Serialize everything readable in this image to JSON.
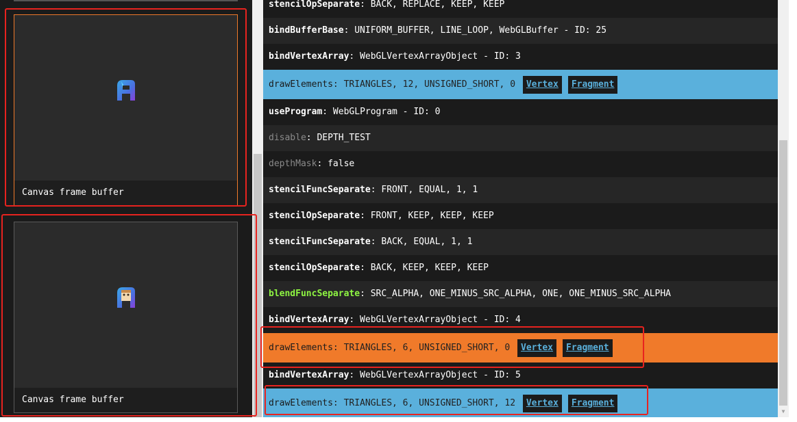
{
  "frames": [
    {
      "label": "Canvas frame buffer",
      "selected": true
    },
    {
      "label": "Canvas frame buffer",
      "selected": false
    }
  ],
  "colors": {
    "accent_blue": "#5ab0dc",
    "accent_orange": "#f07a2a",
    "highlight_green": "#8ef542",
    "annotation_red": "#e8231f",
    "panel_bg": "#1b1b1b"
  },
  "commands": [
    {
      "name": "stencilOpSeparate",
      "args": ": BACK, REPLACE, KEEP, KEEP"
    },
    {
      "name": "bindBufferBase",
      "args": ": UNIFORM_BUFFER, LINE_LOOP, WebGLBuffer - ID: 25"
    },
    {
      "name": "bindVertexArray",
      "args": ": WebGLVertexArrayObject - ID: 3"
    },
    {
      "name": "drawElements",
      "args": ": TRIANGLES, 12, UNSIGNED_SHORT, 0",
      "vertex": "Vertex",
      "fragment": "Fragment"
    },
    {
      "name": "useProgram",
      "args": ": WebGLProgram - ID: 0"
    },
    {
      "name": "disable",
      "args": ": DEPTH_TEST"
    },
    {
      "name": "depthMask",
      "args": ": false"
    },
    {
      "name": "stencilFuncSeparate",
      "args": ": FRONT, EQUAL, 1, 1"
    },
    {
      "name": "stencilOpSeparate",
      "args": ": FRONT, KEEP, KEEP, KEEP"
    },
    {
      "name": "stencilFuncSeparate",
      "args": ": BACK, EQUAL, 1, 1"
    },
    {
      "name": "stencilOpSeparate",
      "args": ": BACK, KEEP, KEEP, KEEP"
    },
    {
      "name": "blendFuncSeparate",
      "args": ": SRC_ALPHA, ONE_MINUS_SRC_ALPHA, ONE, ONE_MINUS_SRC_ALPHA"
    },
    {
      "name": "bindVertexArray",
      "args": ": WebGLVertexArrayObject - ID: 4"
    },
    {
      "name": "drawElements",
      "args": ": TRIANGLES, 6, UNSIGNED_SHORT, 0",
      "vertex": "Vertex",
      "fragment": "Fragment"
    },
    {
      "name": "bindVertexArray",
      "args": ": WebGLVertexArrayObject - ID: 5"
    },
    {
      "name": "drawElements",
      "args": ": TRIANGLES, 6, UNSIGNED_SHORT, 12",
      "vertex": "Vertex",
      "fragment": "Fragment"
    }
  ]
}
